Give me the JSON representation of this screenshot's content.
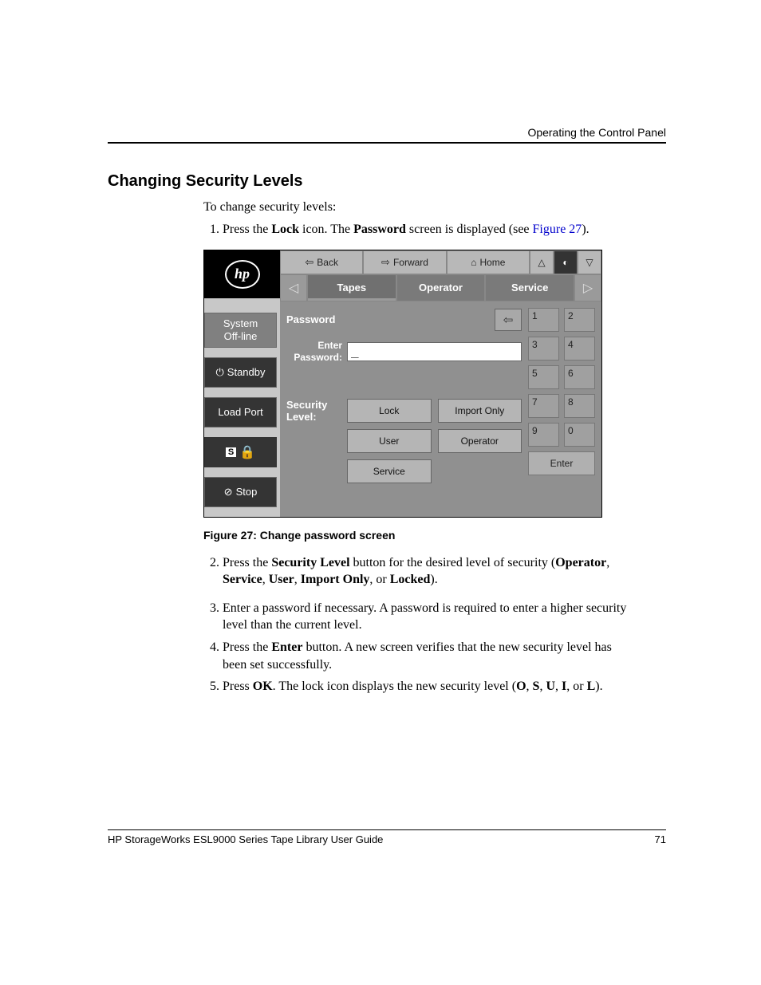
{
  "running_head": "Operating the Control Panel",
  "section_title": "Changing Security Levels",
  "intro": "To change security levels:",
  "step1_a": "Press the ",
  "step1_b": "Lock",
  "step1_c": " icon. The ",
  "step1_d": "Password",
  "step1_e": " screen is displayed (see ",
  "step1_link": "Figure 27",
  "step1_f": ").",
  "caption": "Figure 27:  Change password screen",
  "step2_a": "Press the ",
  "step2_b": "Security Level",
  "step2_c": " button for the desired level of security (",
  "step2_d": "Operator",
  "step2_e": ", ",
  "step2_f": "Service",
  "step2_g": ", ",
  "step2_h": "User",
  "step2_i": ", ",
  "step2_j": "Import Only",
  "step2_k": ", or ",
  "step2_l": "Locked",
  "step2_m": ").",
  "step3": "Enter a password if necessary. A password is required to enter a higher security level than the current level.",
  "step4_a": "Press the ",
  "step4_b": "Enter",
  "step4_c": " button. A new screen verifies that the new security level has been set successfully.",
  "step5_a": "Press ",
  "step5_b": "OK",
  "step5_c": ". The lock icon displays the new security level (",
  "step5_d": "O",
  "step5_e": ", ",
  "step5_f": "S",
  "step5_g": ", ",
  "step5_h": "U",
  "step5_i": ", ",
  "step5_j": "I",
  "step5_k": ", or ",
  "step5_l": "L",
  "step5_m": ").",
  "footer_left": "HP StorageWorks ESL9000 Series Tape Library User Guide",
  "footer_right": "71",
  "panel": {
    "logo_text": "hp",
    "side": {
      "system1": "System",
      "system2": "Off-line",
      "standby": "Standby",
      "loadport": "Load Port",
      "lock_letter": "S",
      "stop": "Stop"
    },
    "nav": {
      "back": "Back",
      "forward": "Forward",
      "home": "Home"
    },
    "tabs": {
      "tapes": "Tapes",
      "operator": "Operator",
      "service": "Service"
    },
    "form": {
      "password": "Password",
      "enter1": "Enter",
      "enter2": "Password:",
      "input_value": "_",
      "seclevel1": "Security",
      "seclevel2": "Level:",
      "buttons": {
        "lock": "Lock",
        "import": "Import Only",
        "user": "User",
        "operator": "Operator",
        "service": "Service"
      }
    },
    "keypad": {
      "k1": "1",
      "k2": "2",
      "k3": "3",
      "k4": "4",
      "k5": "5",
      "k6": "6",
      "k7": "7",
      "k8": "8",
      "k9": "9",
      "k0": "0",
      "enter": "Enter"
    }
  }
}
